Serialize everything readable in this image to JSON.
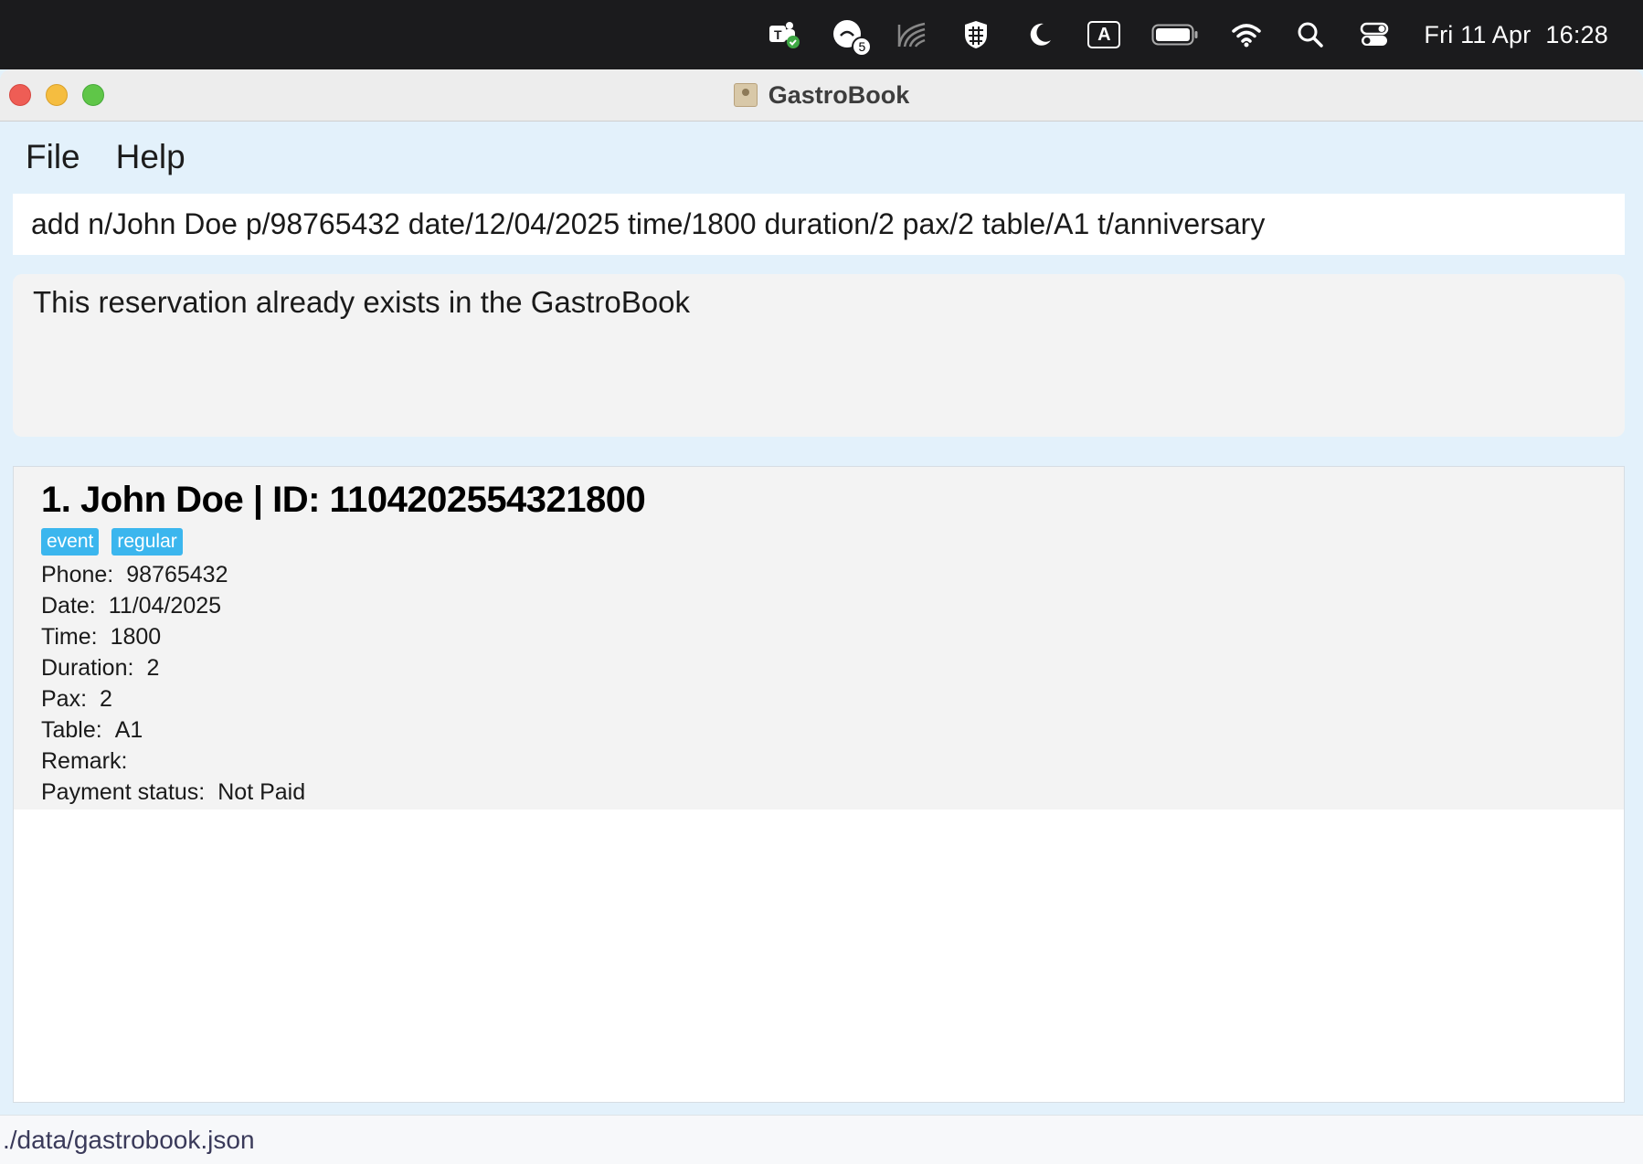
{
  "menubar": {
    "icons": [
      "teams-icon",
      "notification-badge-icon",
      "wave-icon",
      "shield-icon",
      "moon-icon",
      "input-source-icon",
      "battery-icon",
      "wifi-icon",
      "search-icon",
      "control-center-icon"
    ],
    "notification_count": "5",
    "input_source_label": "A",
    "day_date": "Fri 11 Apr",
    "time": "16:28"
  },
  "window": {
    "title": "GastroBook"
  },
  "app_menu": {
    "items": [
      {
        "label": "File"
      },
      {
        "label": "Help"
      }
    ]
  },
  "command": {
    "value": "add n/John Doe p/98765432 date/12/04/2025 time/1800 duration/2 pax/2 table/A1 t/anniversary"
  },
  "result": {
    "message": "This reservation already exists in the GastroBook"
  },
  "reservations": [
    {
      "title": "1. John Doe | ID: 1104202554321800",
      "tags": [
        "event",
        "regular"
      ],
      "phone_label": "Phone:",
      "phone": "98765432",
      "date_label": "Date:",
      "date": "11/04/2025",
      "time_label": "Time:",
      "time": "1800",
      "duration_label": "Duration:",
      "duration": "2",
      "pax_label": "Pax:",
      "pax": "2",
      "table_label": "Table:",
      "table": "A1",
      "remark_label": "Remark:",
      "remark": "",
      "payment_label": "Payment status:",
      "payment": "Not Paid"
    }
  ],
  "status_bar": {
    "file_path": "./data/gastrobook.json"
  }
}
